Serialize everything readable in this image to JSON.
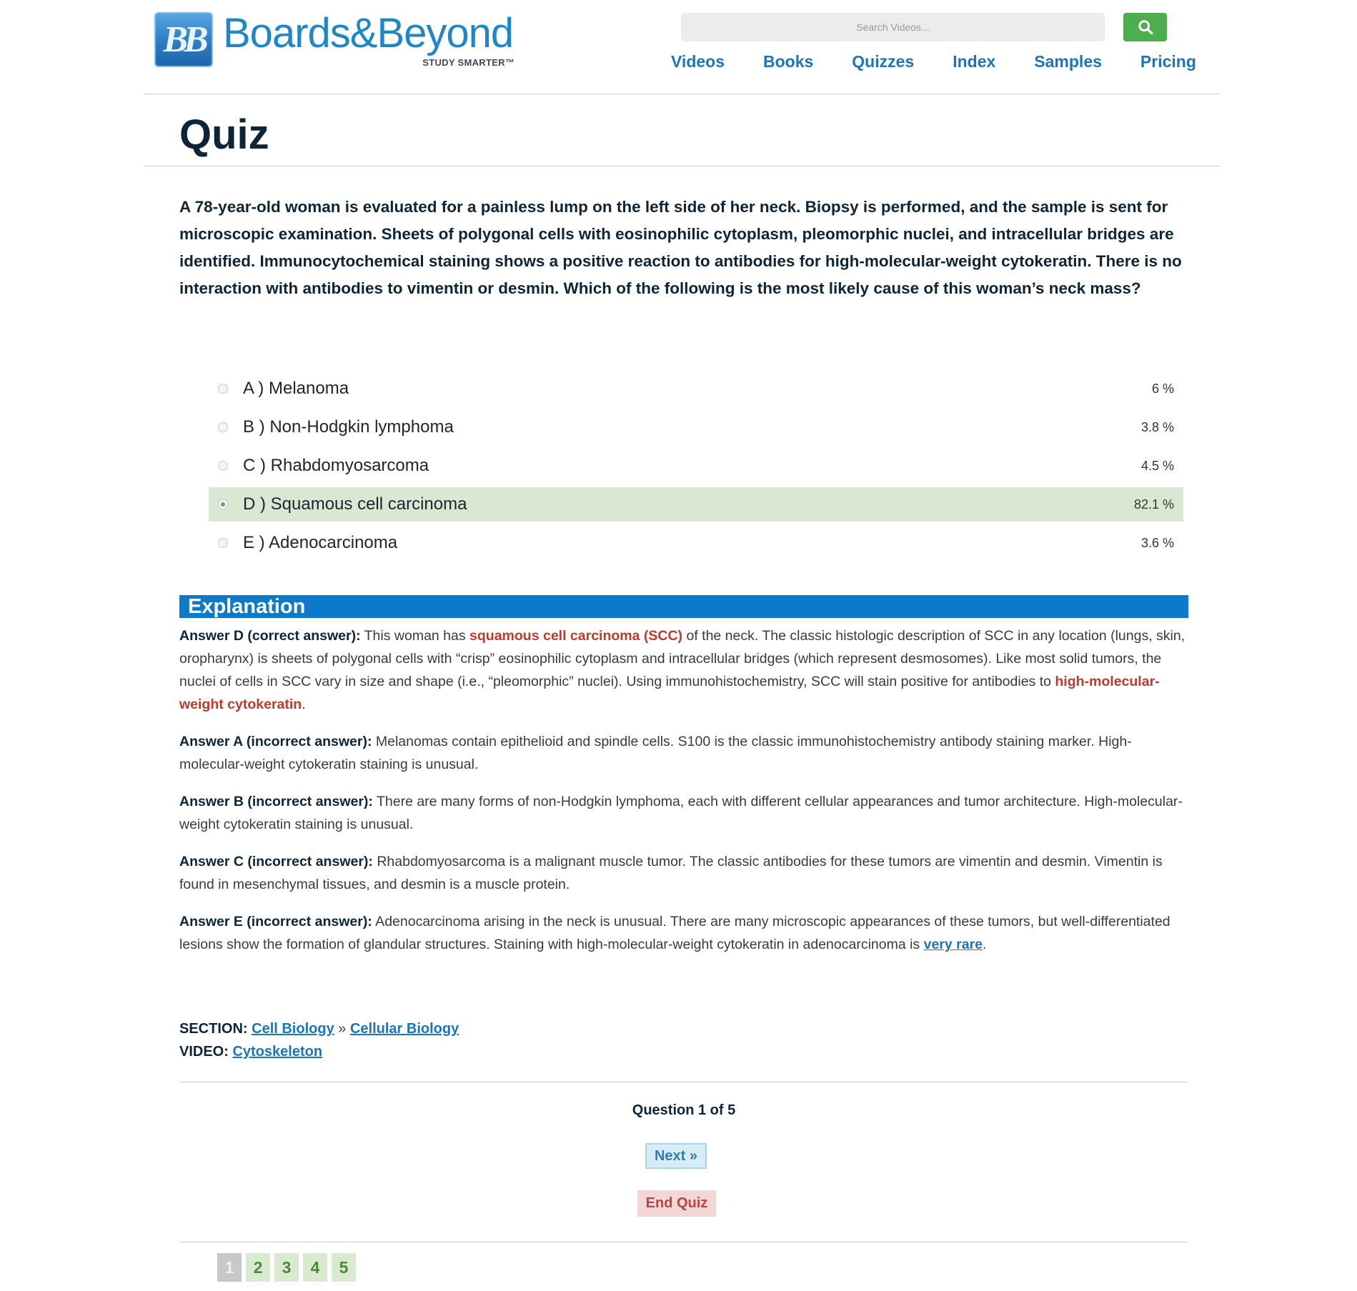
{
  "header": {
    "logo_mark": "BB",
    "logo_name": "Boards&Beyond",
    "logo_tagline": "STUDY SMARTER™",
    "search_placeholder": "Search Videos...",
    "nav": [
      "Videos",
      "Books",
      "Quizzes",
      "Index",
      "Samples",
      "Pricing"
    ]
  },
  "page_title": "Quiz",
  "question": "A 78-year-old woman is evaluated for a painless lump on the left side of her neck. Biopsy is performed, and the sample is sent for microscopic examination. Sheets of polygonal cells with eosinophilic cytoplasm, pleomorphic nuclei, and intracellular bridges are identified. Immunocytochemical staining shows a positive reaction to antibodies for high-molecular-weight cytokeratin. There is no interaction with antibodies to vimentin or desmin. Which of the following is the most likely cause of this woman’s neck mass?",
  "answers": [
    {
      "label": "A ) Melanoma",
      "pct": "6 %"
    },
    {
      "label": "B ) Non-Hodgkin lymphoma",
      "pct": "3.8 %"
    },
    {
      "label": "C ) Rhabdomyosarcoma",
      "pct": "4.5 %"
    },
    {
      "label": "D ) Squamous cell carcinoma",
      "pct": "82.1 %",
      "selected": true
    },
    {
      "label": "E ) Adenocarcinoma",
      "pct": "3.6 %"
    }
  ],
  "explanation": {
    "title": "Explanation",
    "d": {
      "lead": "Answer D (correct answer):",
      "t1": " This woman has ",
      "hl1": "squamous cell carcinoma (SCC)",
      "t2": " of the neck. The classic histologic description of SCC in any location (lungs, skin, oropharynx) is sheets of polygonal cells with “crisp” eosinophilic cytoplasm and intracellular bridges (which represent desmosomes). Like most solid tumors, the nuclei of cells in SCC vary in size and shape (i.e., “pleomorphic” nuclei). Using immunohistochemistry, SCC will stain positive for antibodies to ",
      "hl2": "high-molecular-weight cytokeratin",
      "t3": "."
    },
    "a": {
      "lead": "Answer A (incorrect answer):",
      "text": " Melanomas contain epithelioid and spindle cells. S100 is the classic immunohistochemistry antibody staining marker. High-molecular-weight cytokeratin staining is unusual."
    },
    "b": {
      "lead": "Answer B (incorrect answer):",
      "text": " There are many forms of non-Hodgkin lymphoma, each with different cellular appearances and tumor architecture. High-molecular-weight cytokeratin staining is unusual."
    },
    "c": {
      "lead": "Answer C (incorrect answer):",
      "text": " Rhabdomyosarcoma is a malignant muscle tumor. The classic antibodies for these tumors are vimentin and desmin. Vimentin is found in mesenchymal tissues, and desmin is a muscle protein."
    },
    "e": {
      "lead": "Answer E (incorrect answer):",
      "text": " Adenocarcinoma arising in the neck is unusual. There are many microscopic appearances of these tumors, but well-differentiated lesions show the formation of glandular structures. Staining with high-molecular-weight cytokeratin in adenocarcinoma is ",
      "link": "very rare",
      "end": "."
    }
  },
  "meta": {
    "section_label": "SECTION:",
    "section_link1": "Cell Biology",
    "separator": "»",
    "section_link2": "Cellular Biology",
    "video_label": "VIDEO:",
    "video_link": "Cytoskeleton"
  },
  "footer": {
    "question_count": "Question 1 of 5",
    "next": "Next »",
    "end_quiz": "End Quiz",
    "pages": [
      "1",
      "2",
      "3",
      "4",
      "5"
    ],
    "current_page": "1"
  },
  "colors": {
    "brand_blue": "#1c75bc",
    "explanation_bar": "#0c7ac8",
    "selected_row": "#d9e8d2",
    "search_button": "#4cae4c",
    "highlight_red": "#c0392b"
  }
}
